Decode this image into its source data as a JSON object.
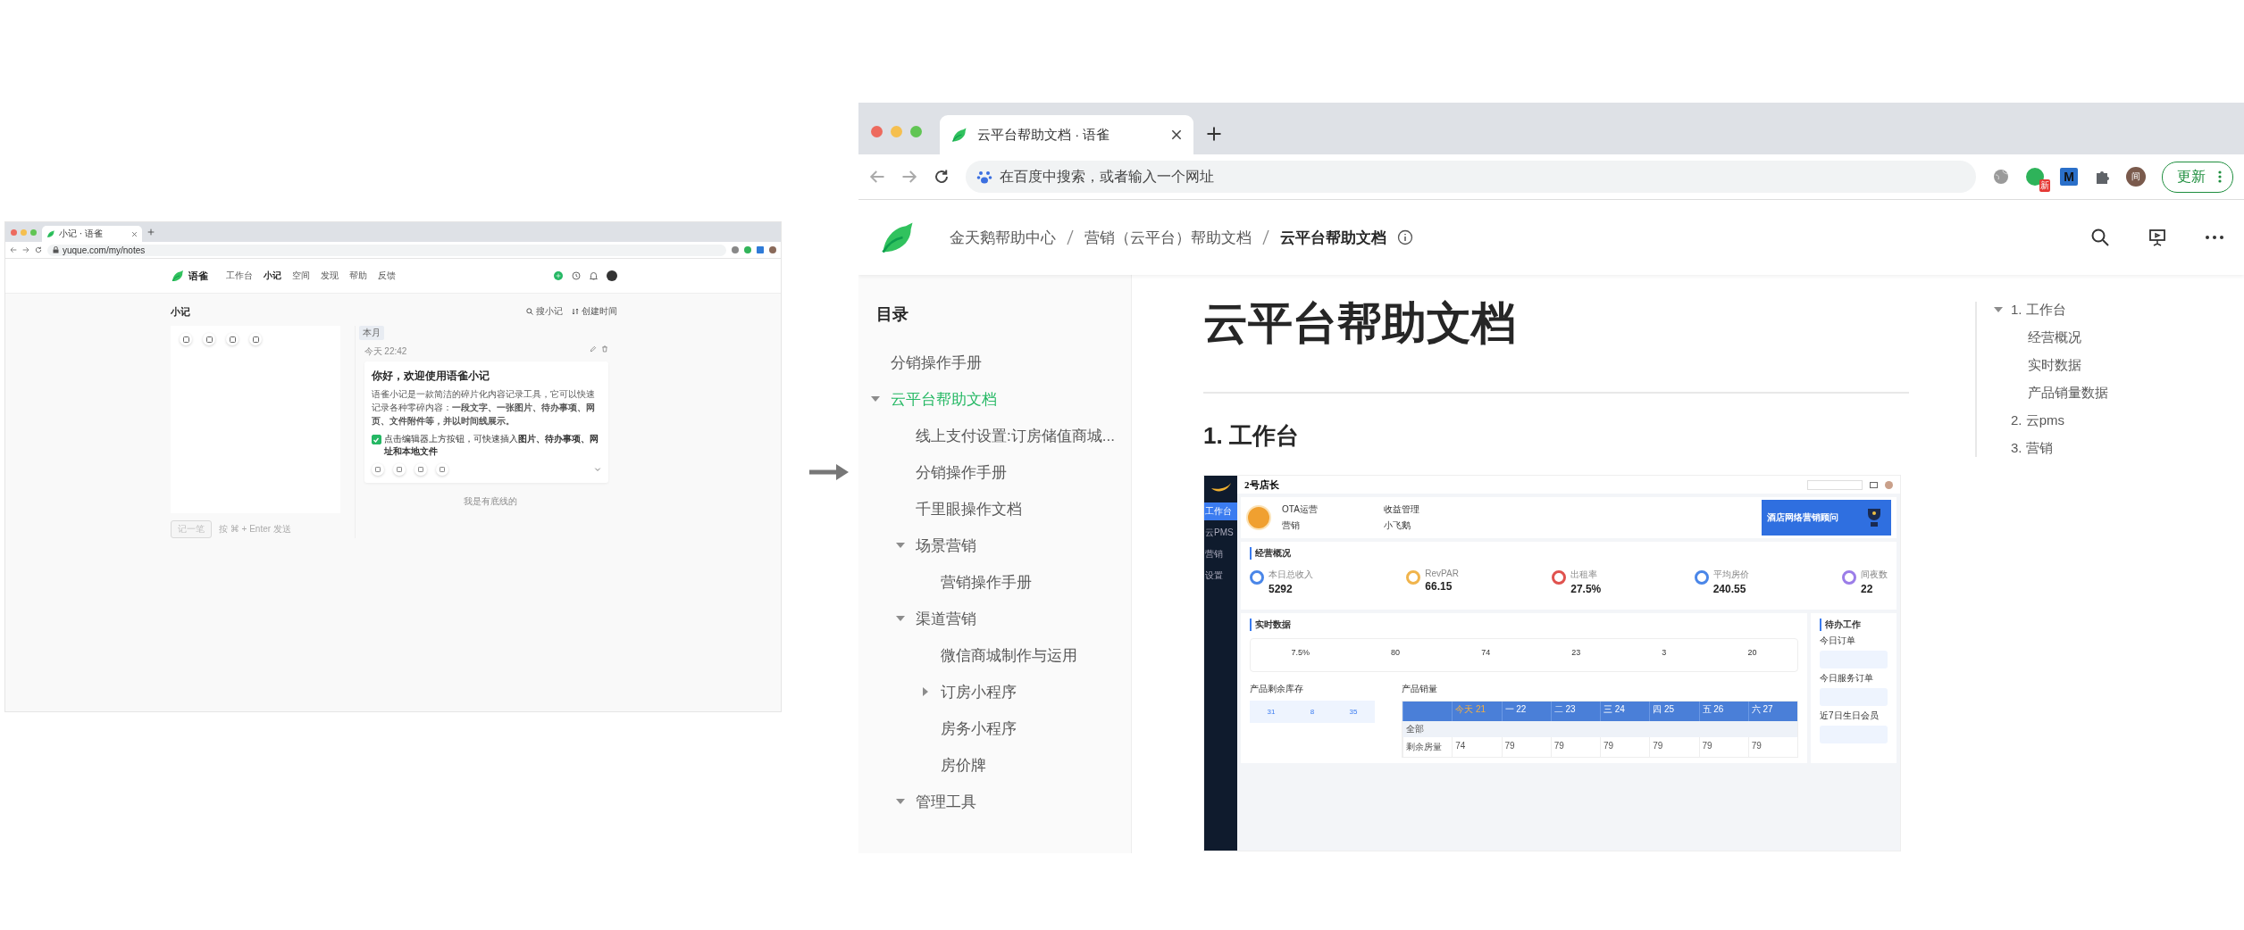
{
  "left_screenshot": {
    "tab_title": "小记 · 语雀",
    "address": "yuque.com/my/notes",
    "app": {
      "logo_text": "语雀",
      "nav": [
        {
          "label": "工作台",
          "selected": false
        },
        {
          "label": "小记",
          "selected": true
        },
        {
          "label": "空间",
          "selected": false
        },
        {
          "label": "发现",
          "selected": false
        },
        {
          "label": "帮助",
          "selected": false
        },
        {
          "label": "反馈",
          "selected": false
        }
      ],
      "page_title": "小记",
      "search_label": "搜小记",
      "sort_label": "创建时间",
      "submit_button": {
        "label": "记一笔",
        "disabled": true
      },
      "submit_hint": "按 ⌘ + Enter 发送",
      "month_tag": "本月",
      "note": {
        "time": "今天 22:42",
        "title": "你好，欢迎使用语雀小记",
        "body": "语雀小记是一款简洁的碎片化内容记录工具，它可以快速记录各种零碎内容：**一段文字、一张图片、待办事项、网页、文件附件等，并以时间线展示。**",
        "checklist_item": {
          "text": "点击编辑器上方按钮，可快速插入**图片、待办事项、网址和本地文件**",
          "checked": true
        }
      },
      "end_text": "我是有底线的"
    }
  },
  "right_screenshot": {
    "tab_title": "云平台帮助文档 · 语雀",
    "address_placeholder": "在百度中搜索，或者输入一个网址",
    "extension_badge": "新",
    "extension_letter": "M",
    "profile_initial": "间",
    "update_button": "更新",
    "breadcrumbs": [
      {
        "label": "金天鹅帮助中心",
        "current": false
      },
      {
        "label": "营销（云平台）帮助文档",
        "current": false
      },
      {
        "label": "云平台帮助文档",
        "current": true
      }
    ],
    "toc_title": "目录",
    "tree": [
      {
        "label": "分销操作手册",
        "selected": false
      },
      {
        "label": "云平台帮助文档",
        "selected": true,
        "expanded": true,
        "children": [
          {
            "label": "线上支付设置:订房储值商城...",
            "selected": false
          },
          {
            "label": "分销操作手册",
            "selected": false
          },
          {
            "label": "千里眼操作文档",
            "selected": false
          },
          {
            "label": "场景营销",
            "selected": false,
            "expanded": true,
            "children": [
              {
                "label": "营销操作手册",
                "selected": false
              }
            ]
          },
          {
            "label": "渠道营销",
            "selected": false,
            "expanded": true,
            "children": [
              {
                "label": "微信商城制作与运用",
                "selected": false
              },
              {
                "label": "订房小程序",
                "selected": false,
                "expanded": false
              },
              {
                "label": "房务小程序",
                "selected": false
              },
              {
                "label": "房价牌",
                "selected": false
              }
            ]
          },
          {
            "label": "管理工具",
            "selected": false,
            "expanded": true
          }
        ]
      }
    ],
    "doc_title": "云平台帮助文档",
    "section_heading": "1. 工作台",
    "outline": [
      {
        "label": "1. 工作台",
        "expanded": true,
        "children": [
          {
            "label": "经营概况"
          },
          {
            "label": "实时数据"
          },
          {
            "label": "产品销量数据"
          }
        ]
      },
      {
        "label": "2. 云pms"
      },
      {
        "label": "3. 营销"
      }
    ],
    "embedded_screenshot": {
      "brand": "2号店长",
      "nav": [
        {
          "label": "工作台",
          "selected": true
        },
        {
          "label": "云PMS",
          "selected": false
        },
        {
          "label": "营销",
          "selected": false
        },
        {
          "label": "设置",
          "selected": false
        }
      ],
      "notices": [
        "OTA运营",
        "收益管理",
        "营销",
        "小飞鹅"
      ],
      "banner_title": "酒店网络营销顾问",
      "overview_title": "经营概况",
      "kpis": [
        {
          "label": "本日总收入",
          "value": "5292",
          "color": "#4a86e8"
        },
        {
          "label": "RevPAR",
          "value": "66.15",
          "color": "#f0b44c"
        },
        {
          "label": "出租率",
          "value": "27.5%",
          "color": "#e0524e"
        },
        {
          "label": "平均房价",
          "value": "240.55",
          "color": "#4a86e8"
        },
        {
          "label": "间夜数",
          "value": "22",
          "color": "#9b7de8"
        }
      ],
      "realtime_title": "实时数据",
      "realtime_values": [
        "7.5%",
        "80",
        "74",
        "23",
        "3",
        "20"
      ],
      "todo_title": "待办工作",
      "todo_sections": [
        "今日订单",
        "今日服务订单",
        "近7日生日会员"
      ],
      "inventory_title": "产品剩余库存",
      "inventory_values": [
        "31",
        "8",
        "35"
      ],
      "sales_title": "产品销量",
      "sales_days": [
        {
          "weekday": "今天",
          "date": "21",
          "today": true
        },
        {
          "weekday": "一",
          "date": "22",
          "today": false
        },
        {
          "weekday": "二",
          "date": "23",
          "today": false
        },
        {
          "weekday": "三",
          "date": "24",
          "today": false
        },
        {
          "weekday": "四",
          "date": "25",
          "today": false
        },
        {
          "weekday": "五",
          "date": "26",
          "today": false
        },
        {
          "weekday": "六",
          "date": "27",
          "today": false
        }
      ],
      "sales_group": "全部",
      "sales_row": {
        "label": "剩余房量",
        "values": [
          "74",
          "79",
          "79",
          "79",
          "79",
          "79",
          "79"
        ]
      }
    }
  }
}
